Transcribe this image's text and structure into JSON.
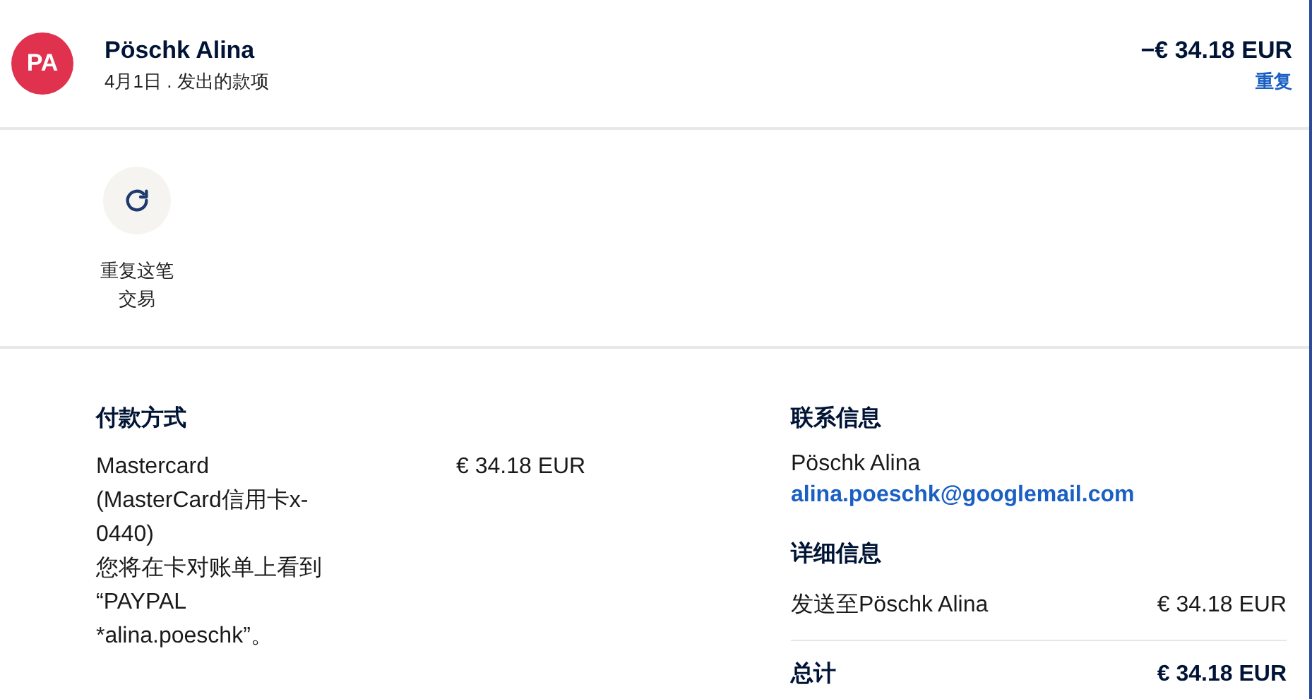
{
  "header": {
    "avatar": "PA",
    "name": "Pöschk Alina",
    "subtitle": "4月1日 . 发出的款项",
    "amount": "−€ 34.18 EUR",
    "repeat_link": "重复"
  },
  "actions": [
    {
      "kind": "repeat",
      "label": "重复这笔交易"
    }
  ],
  "payment_method": {
    "title": "付款方式",
    "card": [
      "Mastercard",
      "(MasterCard信用卡x-0440)"
    ],
    "note": [
      "您将在卡对账单上看到",
      "“PAYPAL *alina.poeschk”。"
    ],
    "amount": "€ 34.18 EUR"
  },
  "contact": {
    "title": "联系信息",
    "name": "Pöschk Alina",
    "email": "alina.poeschk@googlemail.com"
  },
  "details": {
    "title": "详细信息",
    "rows": [
      {
        "label": "发送至Pöschk Alina",
        "amount": "€ 34.18 EUR"
      }
    ],
    "total": {
      "label": "总计",
      "amount": "€ 34.18 EUR"
    }
  }
}
